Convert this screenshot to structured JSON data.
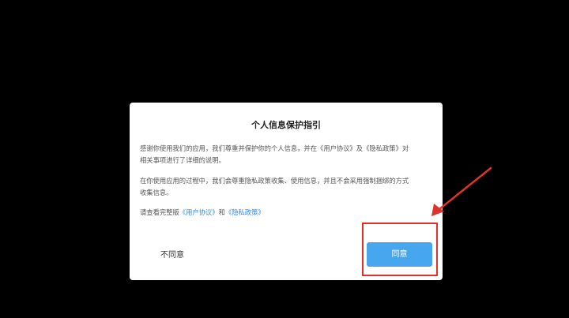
{
  "dialog": {
    "title": "个人信息保护指引",
    "para1_text": "感谢你使用我们的应用，我们尊重并保护你的个人信息，并在《用户协议》及《隐私政策》对相关事项进行了详细的说明。",
    "para2_text": "在你使用应用的过程中，我们会尊重隐私政策收集、使用信息，并且不会采用强制捆绑的方式收集信息。",
    "para3_prefix": "请查看完整版",
    "para3_link_agreement": "《用户协议》",
    "para3_and": "和",
    "para3_link_privacy": "《隐私政策》",
    "decline_label": "不同意",
    "agree_label": "同意"
  },
  "colors": {
    "background": "#000000",
    "dialog_background": "#ffffff",
    "link": "#2e8be6",
    "agree_button": "#46a7ee",
    "annotation": "#e0322b"
  }
}
